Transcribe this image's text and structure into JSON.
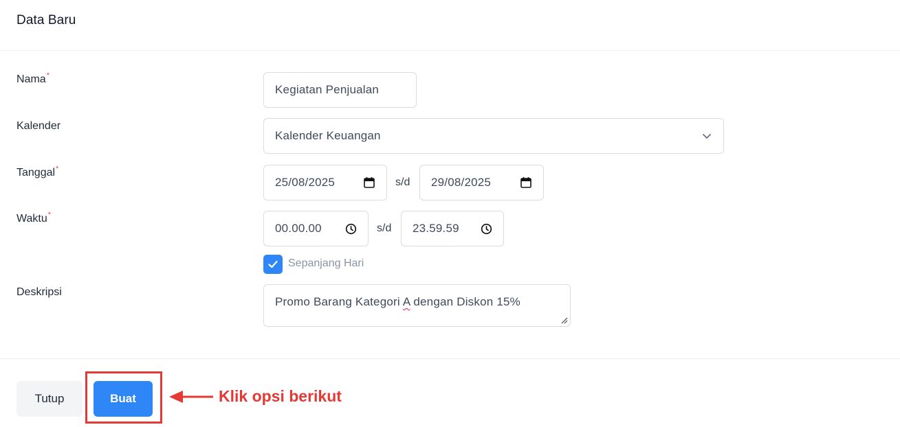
{
  "modal": {
    "title": "Data Baru"
  },
  "form": {
    "name": {
      "label": "Nama",
      "required_mark": "*",
      "value": "Kegiatan Penjualan"
    },
    "calendar": {
      "label": "Kalender",
      "value": "Kalender Keuangan",
      "icon": "chevron-down-icon"
    },
    "date": {
      "label": "Tanggal",
      "required_mark": "*",
      "start": "25/08/2025",
      "separator": "s/d",
      "end": "29/08/2025",
      "icon": "calendar-icon"
    },
    "time": {
      "label": "Waktu",
      "required_mark": "*",
      "start": "00.00.00",
      "separator": "s/d",
      "end": "23.59.59",
      "icon": "clock-icon"
    },
    "all_day": {
      "label": "Sepanjang Hari",
      "checked": true
    },
    "description": {
      "label": "Deskripsi",
      "value_before": "Promo Barang Kategori ",
      "value_flagged": "A",
      "value_after": " dengan Diskon 15%"
    }
  },
  "footer": {
    "close_label": "Tutup",
    "create_label": "Buat"
  },
  "annotation": {
    "text": "Klik opsi berikut",
    "color": "#e53935"
  },
  "colors": {
    "primary": "#2f86f6",
    "required": "#ef4444"
  }
}
